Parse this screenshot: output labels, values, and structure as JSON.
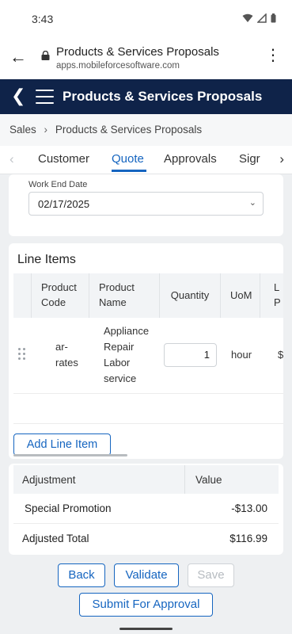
{
  "status_bar": {
    "time": "3:43"
  },
  "browser": {
    "page_title": "Products & Services Proposals",
    "url": "apps.mobileforcesoftware.com"
  },
  "app_header": {
    "title": "Products & Services Proposals"
  },
  "breadcrumb": {
    "items": [
      "Sales",
      "Products & Services Proposals"
    ]
  },
  "tabs": {
    "items": [
      "Customer",
      "Quote",
      "Approvals",
      "Sigr"
    ],
    "active": "Quote"
  },
  "work_end": {
    "label": "Work End Date",
    "value": "02/17/2025"
  },
  "line_items": {
    "title": "Line Items",
    "columns": [
      [
        "Product",
        "Code"
      ],
      [
        "Product",
        "Name"
      ],
      [
        "Quantity"
      ],
      [
        "UoM"
      ],
      [
        "L",
        "P"
      ]
    ],
    "rows": [
      {
        "product_code": [
          "ar-",
          "rates"
        ],
        "product_name": [
          "Appliance",
          "Repair",
          "Labor",
          "service"
        ],
        "quantity": "1",
        "uom": "hour",
        "list_price_partial": "$"
      }
    ],
    "add_button": "Add Line Item"
  },
  "adjustments": {
    "headers": [
      "Adjustment",
      "Value"
    ],
    "rows": [
      {
        "label": "Special Promotion",
        "value": "-$13.00"
      }
    ],
    "total_label": "Adjusted Total",
    "total_value": "$116.99"
  },
  "buttons": {
    "back": "Back",
    "validate": "Validate",
    "save": "Save",
    "submit": "Submit For Approval"
  },
  "colors": {
    "header_bg": "#0f2349",
    "accent": "#1565c0"
  }
}
